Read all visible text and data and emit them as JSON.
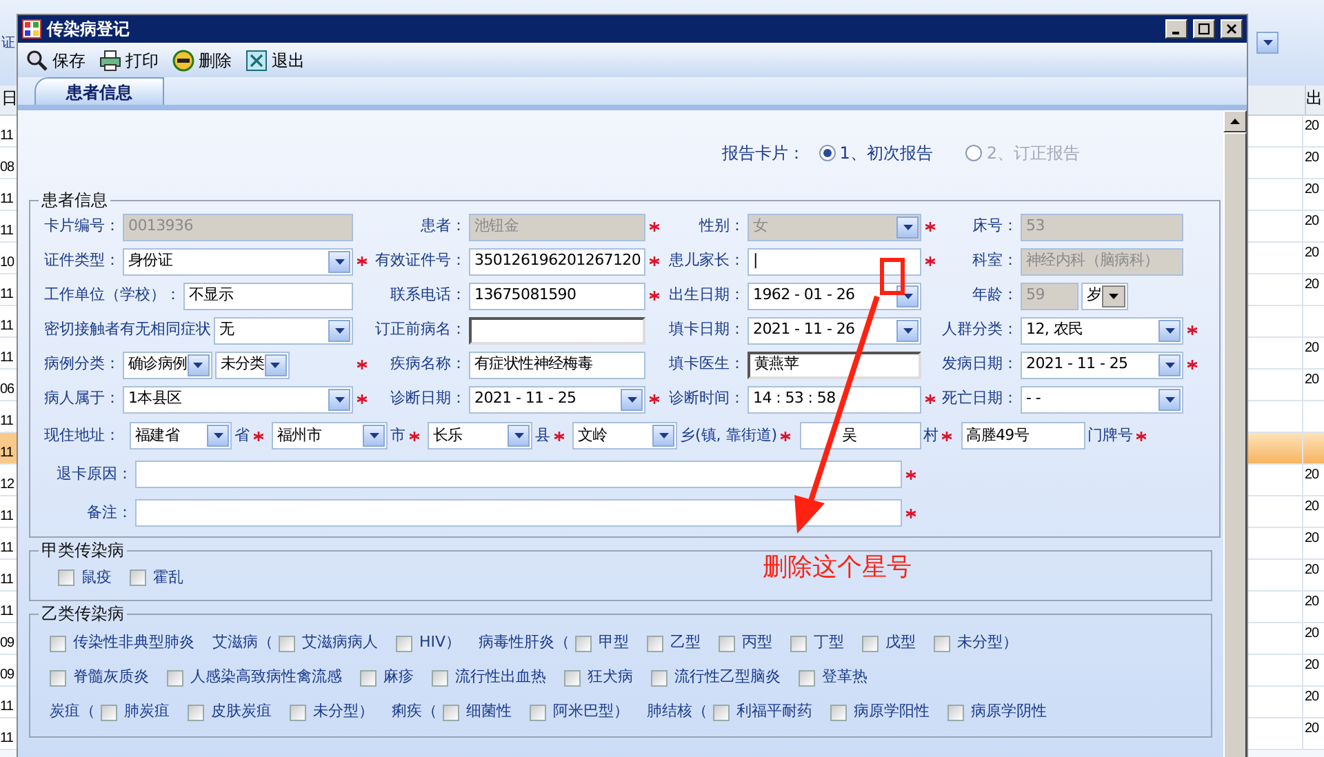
{
  "background": {
    "top_label": "证",
    "left_header": "日",
    "right_header": "出",
    "left_cells": [
      "11",
      "08",
      "11",
      "11",
      "10",
      "11",
      "11",
      "11",
      "06",
      "11",
      "11",
      "12",
      "11",
      "11",
      "11",
      "11",
      "09",
      "09",
      "11",
      "11"
    ],
    "right_cells": [
      "20",
      "20",
      "20",
      "20",
      "20",
      "20",
      "",
      "20",
      "20",
      "",
      "",
      "20",
      "20",
      "20",
      "20",
      "20",
      "20",
      "20",
      "20",
      "20"
    ]
  },
  "window": {
    "title": "传染病登记"
  },
  "toolbar": [
    {
      "kind": "search",
      "label": "保存"
    },
    {
      "kind": "print",
      "label": "打印"
    },
    {
      "kind": "delete",
      "label": "删除"
    },
    {
      "kind": "exit",
      "label": "退出"
    }
  ],
  "tabs": [
    {
      "label": "患者信息",
      "selected": true
    }
  ],
  "report_card": {
    "label": "报告卡片：",
    "options": [
      {
        "label": "1、初次报告",
        "selected": true,
        "disabled": false
      },
      {
        "label": "2、订正报告",
        "selected": false,
        "disabled": true
      }
    ]
  },
  "patient_group": {
    "title": "患者信息",
    "rows": [
      {
        "cells": [
          {
            "label": "卡片编号：",
            "required": false,
            "inputs": [
              {
                "kind": "text",
                "value": "0013936",
                "disabled": true
              }
            ]
          },
          {
            "label": "患者：",
            "required": true,
            "inputs": [
              {
                "kind": "text",
                "value": "池钮金",
                "disabled": true
              }
            ]
          },
          {
            "label": "性别：",
            "required": true,
            "inputs": [
              {
                "kind": "select",
                "value": "女",
                "disabled": true
              }
            ]
          },
          {
            "label": "床号：",
            "required": false,
            "inputs": [
              {
                "kind": "text",
                "value": "53",
                "disabled": true
              }
            ]
          }
        ]
      },
      {
        "cells": [
          {
            "label": "证件类型：",
            "required": true,
            "inputs": [
              {
                "kind": "select",
                "value": "身份证",
                "disabled": false
              }
            ]
          },
          {
            "label": "有效证件号：",
            "required": true,
            "inputs": [
              {
                "kind": "text",
                "value": "350126196201267120",
                "disabled": false
              }
            ]
          },
          {
            "label": "患儿家长：",
            "required": true,
            "inputs": [
              {
                "kind": "text",
                "value": "|",
                "disabled": false
              }
            ]
          },
          {
            "label": "科室：",
            "required": false,
            "inputs": [
              {
                "kind": "text",
                "value": "神经内科（脑病科）",
                "disabled": true
              }
            ]
          }
        ]
      },
      {
        "cells": [
          {
            "label": "工作单位（学校）：",
            "required": false,
            "inputs": [
              {
                "kind": "text",
                "value": "不显示",
                "disabled": false
              }
            ]
          },
          {
            "label": "联系电话：",
            "required": true,
            "inputs": [
              {
                "kind": "text",
                "value": "13675081590",
                "disabled": false
              }
            ]
          },
          {
            "label": "出生日期：",
            "required": false,
            "inputs": [
              {
                "kind": "date",
                "value": "1962 - 01 - 26",
                "disabled": false
              }
            ]
          },
          {
            "label": "年龄：",
            "required": false,
            "inputs": [
              {
                "kind": "text",
                "value": "59",
                "disabled": true
              },
              {
                "kind": "combo",
                "value": "岁",
                "disabled": false
              }
            ]
          }
        ]
      },
      {
        "cells": [
          {
            "label": "密切接触者有无相同症状",
            "required": false,
            "inputs": [
              {
                "kind": "select",
                "value": "无",
                "disabled": false
              }
            ]
          },
          {
            "label": "订正前病名：",
            "required": false,
            "inputs": [
              {
                "kind": "sunken",
                "disabled": false
              }
            ]
          },
          {
            "label": "填卡日期：",
            "required": false,
            "inputs": [
              {
                "kind": "date",
                "value": "2021 - 11 - 26",
                "disabled": false
              }
            ]
          },
          {
            "label": "人群分类：",
            "required": true,
            "inputs": [
              {
                "kind": "select",
                "value": "12, 农民",
                "disabled": false
              }
            ]
          }
        ]
      },
      {
        "cells": [
          {
            "label": "病例分类：",
            "required": true,
            "inputs": [
              {
                "kind": "select",
                "value": "确诊病例",
                "disabled": false
              },
              {
                "kind": "select",
                "value": "未分类",
                "disabled": false
              }
            ]
          },
          {
            "label": "疾病名称：",
            "required": false,
            "inputs": [
              {
                "kind": "text",
                "value": "有症状性神经梅毒",
                "disabled": false
              }
            ]
          },
          {
            "label": "填卡医生：",
            "required": false,
            "inputs": [
              {
                "kind": "sunken",
                "value": "黄燕苹",
                "disabled": false
              }
            ]
          },
          {
            "label": "发病日期：",
            "required": true,
            "inputs": [
              {
                "kind": "date",
                "value": "2021 - 11 - 25",
                "disabled": false
              }
            ]
          }
        ]
      },
      {
        "cells": [
          {
            "label": "病人属于：",
            "required": true,
            "inputs": [
              {
                "kind": "select",
                "value": "1本县区",
                "disabled": false
              }
            ]
          },
          {
            "label": "诊断日期：",
            "required": true,
            "inputs": [
              {
                "kind": "date",
                "value": "2021 - 11 - 25",
                "disabled": false
              }
            ]
          },
          {
            "label": "诊断时间：",
            "required": true,
            "inputs": [
              {
                "kind": "text",
                "value": "14 : 53 : 58",
                "disabled": false
              }
            ]
          },
          {
            "label": "死亡日期：",
            "required": false,
            "inputs": [
              {
                "kind": "date",
                "value": "-   -",
                "disabled": false
              }
            ]
          }
        ]
      }
    ],
    "address": {
      "label": "现住地址：",
      "parts": [
        {
          "kind": "select",
          "value": "福建省",
          "suffix": "省",
          "required": true
        },
        {
          "kind": "select",
          "value": "福州市",
          "suffix": "市",
          "required": true
        },
        {
          "kind": "select",
          "value": "长乐",
          "suffix": "县",
          "required": true
        },
        {
          "kind": "select",
          "value": "文岭",
          "suffix": "乡(镇, 靠街道)",
          "required": true
        },
        {
          "kind": "text",
          "value": "吴",
          "suffix": "村",
          "required": true
        },
        {
          "kind": "text",
          "value": "高塍49号",
          "suffix": "门牌号",
          "required": true
        }
      ]
    },
    "wide_fields": [
      {
        "label": "退卡原因：",
        "required": true
      },
      {
        "label": "备注：",
        "required": true
      }
    ]
  },
  "class_a": {
    "title": "甲类传染病",
    "lines": [
      {
        "items": [
          {
            "kind": "check",
            "text": "鼠疫",
            "checked": false
          },
          {
            "kind": "check",
            "text": "霍乱",
            "checked": false
          }
        ]
      }
    ]
  },
  "class_b": {
    "title": "乙类传染病",
    "lines": [
      {
        "items": [
          {
            "kind": "check",
            "text": "传染性非典型肺炎",
            "checked": false
          },
          {
            "kind": "label",
            "text": "艾滋病（"
          },
          {
            "kind": "check",
            "text": "艾滋病病人",
            "checked": false
          },
          {
            "kind": "check",
            "text": "HIV）",
            "checked": false
          },
          {
            "kind": "label",
            "text": "病毒性肝炎（"
          },
          {
            "kind": "check",
            "text": "甲型",
            "checked": false
          },
          {
            "kind": "check",
            "text": "乙型",
            "checked": false
          },
          {
            "kind": "check",
            "text": "丙型",
            "checked": false
          },
          {
            "kind": "check",
            "text": "丁型",
            "checked": false
          },
          {
            "kind": "check",
            "text": "戊型",
            "checked": false
          },
          {
            "kind": "check",
            "text": "未分型）",
            "checked": false
          }
        ]
      },
      {
        "items": [
          {
            "kind": "check",
            "text": "脊髓灰质炎",
            "checked": false
          },
          {
            "kind": "check",
            "text": "人感染高致病性禽流感",
            "checked": false
          },
          {
            "kind": "check",
            "text": "麻疹",
            "checked": false
          },
          {
            "kind": "check",
            "text": "流行性出血热",
            "checked": false
          },
          {
            "kind": "check",
            "text": "狂犬病",
            "checked": false
          },
          {
            "kind": "check",
            "text": "流行性乙型脑炎",
            "checked": false
          },
          {
            "kind": "check",
            "text": "登革热",
            "checked": false
          }
        ]
      },
      {
        "items": [
          {
            "kind": "label",
            "text": "炭疽（"
          },
          {
            "kind": "check",
            "text": "肺炭疽",
            "checked": false
          },
          {
            "kind": "check",
            "text": "皮肤炭疽",
            "checked": false
          },
          {
            "kind": "check",
            "text": "未分型）",
            "checked": false
          },
          {
            "kind": "label",
            "text": "痢疾（"
          },
          {
            "kind": "check",
            "text": "细菌性",
            "checked": false
          },
          {
            "kind": "check",
            "text": "阿米巴型）",
            "checked": false
          },
          {
            "kind": "label",
            "text": "肺结核（"
          },
          {
            "kind": "check",
            "text": "利福平耐药",
            "checked": false
          },
          {
            "kind": "check",
            "text": "病原学阳性",
            "checked": false
          },
          {
            "kind": "check",
            "text": "病原学阴性",
            "checked": false
          }
        ]
      }
    ]
  },
  "annotation": {
    "text": "删除这个星号"
  }
}
